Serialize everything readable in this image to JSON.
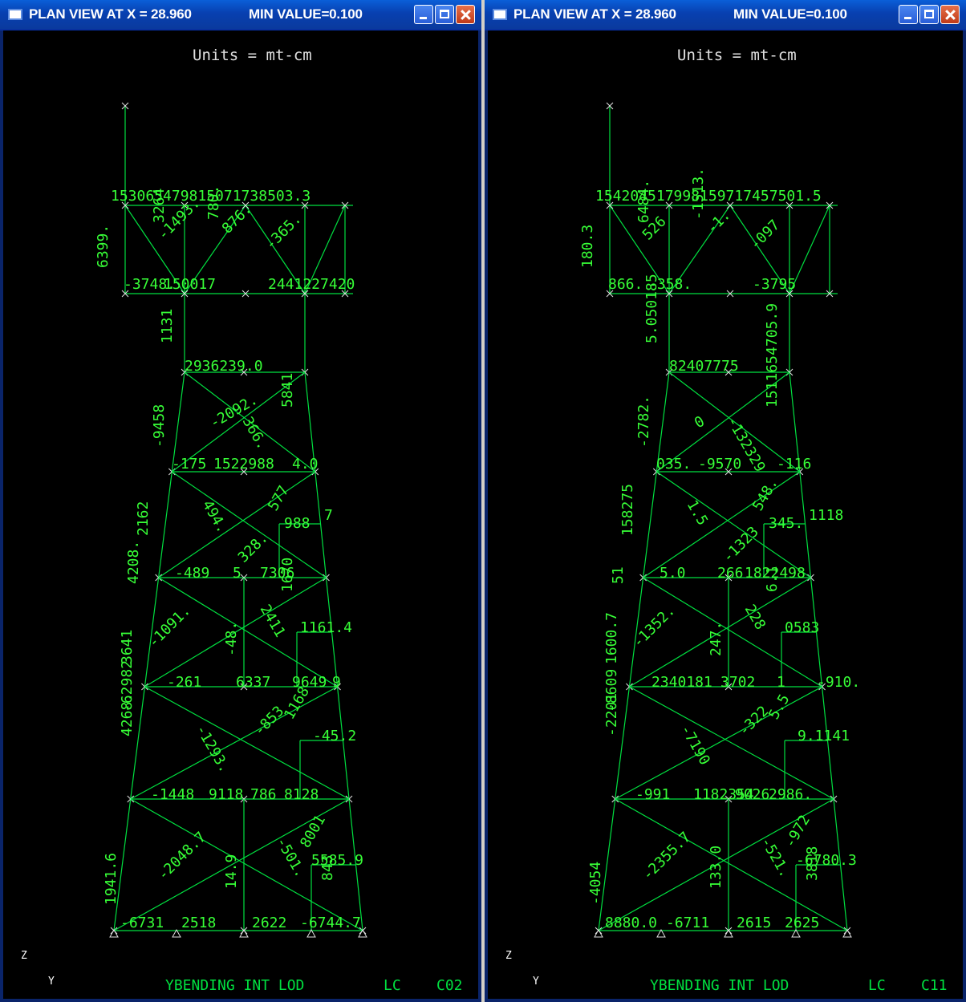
{
  "windows": [
    {
      "title": "PLAN VIEW AT X = 28.960",
      "min_value": "MIN VALUE=0.100",
      "units": "Units = mt-cm",
      "axis_z": "Z",
      "axis_y": "Y",
      "footer_left": "YBENDING INT LOD",
      "footer_lc": "LC",
      "footer_case": "C02",
      "labels": [
        "153065479815071738503.3",
        "6399.",
        "3264",
        "-1493.",
        "780.",
        "876.",
        "-365.",
        "-3748.",
        "150017",
        "2441227420",
        "1131",
        "2936239.0",
        "-2092.",
        "366.",
        "5841",
        "-9458",
        "-175",
        "1522988",
        "4.0",
        "2162",
        "494.",
        "328.",
        "577",
        "988",
        "7",
        "4208.",
        "-489",
        "5",
        "7306",
        "1670",
        "-1091.",
        "-48.",
        "2411",
        "1161.4",
        "3641",
        "4268.",
        "-261",
        "6337",
        "9649",
        "9",
        "-45.2",
        "-1293.",
        "-853",
        "1168",
        "-62982",
        "-1448",
        "9118",
        "786",
        "8128",
        "1941.6",
        "-2048.7",
        "14.9",
        "-501.",
        "8001",
        "843",
        "-6731",
        "2518",
        "2622",
        "-6744.7",
        "5585.9"
      ],
      "label_anchors": []
    },
    {
      "title": "PLAN VIEW AT X = 28.960",
      "min_value": "MIN VALUE=0.100",
      "units": "Units = mt-cm",
      "axis_z": "Z",
      "axis_y": "Y",
      "footer_left": "YBENDING INT LOD",
      "footer_lc": "LC",
      "footer_case": "C11",
      "labels": [
        "154204517998159717457501.5",
        "180.3",
        "6484.",
        "526",
        "-1513.",
        "-1.",
        "-097",
        "866.",
        "-358.",
        "-3795",
        "5.050185",
        "82407775",
        "0",
        "-132329",
        "1511654705.9",
        "-2782.",
        "035.",
        "-9570",
        "-116",
        "158275",
        "1.5",
        "-1323",
        "548.",
        "345.",
        "1118",
        "51",
        "5.0",
        "266",
        "1822498",
        "6.1",
        "-1352.",
        "247.",
        "228",
        "0583",
        "1600.7",
        "-2201",
        "2340181",
        "3702",
        "1",
        "-910.",
        "9.1141",
        "-7190",
        "-322",
        "5.5",
        "-8609",
        "-991",
        "1182354",
        "9026",
        "2986.",
        "-4054",
        "-2355.7",
        "133.0",
        "-521.",
        "-972",
        "3818",
        "8880.0",
        "-6711",
        "2615",
        "2625",
        "-6780.3"
      ],
      "label_anchors": []
    }
  ],
  "colors": {
    "model_lines": "#00e040",
    "labels": "#37ff37",
    "background": "#000000",
    "titlebar": "#0a46c4",
    "units_text": "#e0e0e0"
  }
}
